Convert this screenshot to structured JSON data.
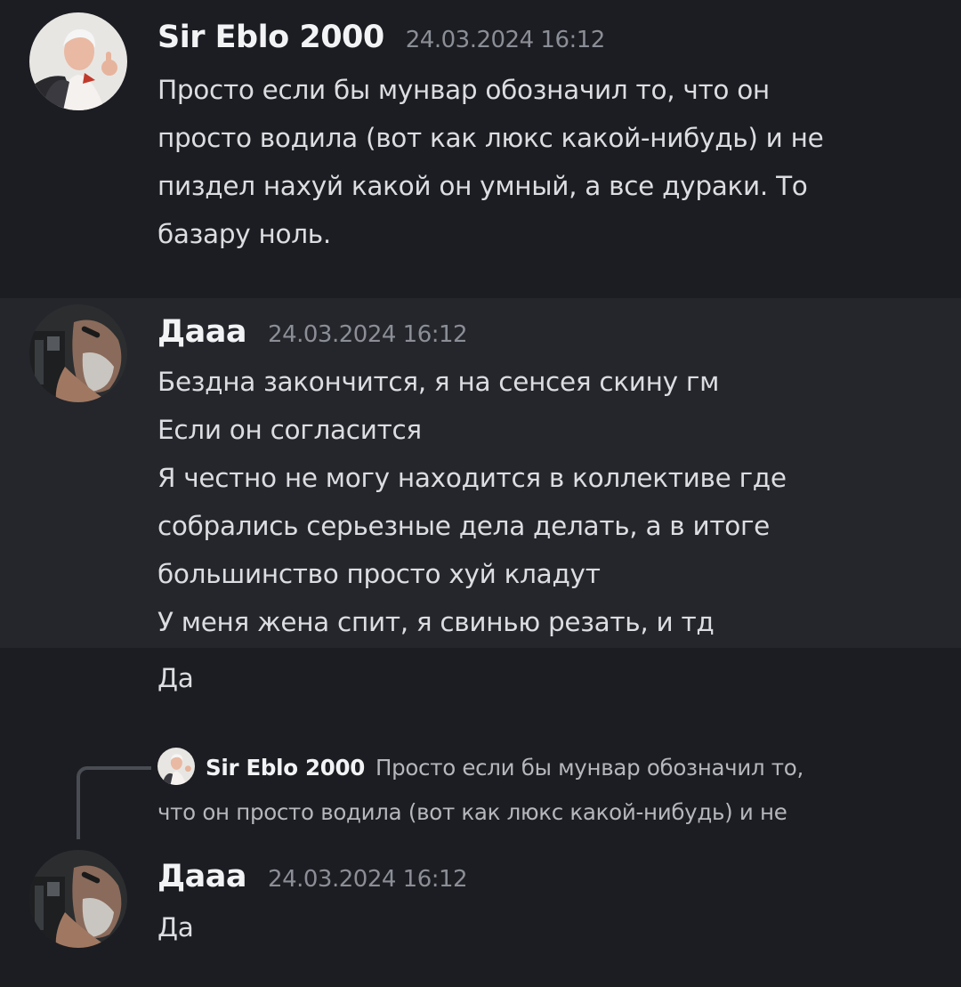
{
  "messages": [
    {
      "author": "Sir Eblo 2000",
      "timestamp": "24.03.2024 16:12",
      "lines": [
        "Просто если бы мунвар обозначил то, что он",
        "просто водила (вот как люкс какой-нибудь) и не",
        "пиздел нахуй какой он умный, а все дураки. То",
        "базару ноль."
      ]
    },
    {
      "author": "Дааа",
      "timestamp": "24.03.2024 16:12",
      "lines": [
        "Бездна закончится, я на сенсея скину гм",
        "Если он согласится",
        "Я честно не могу находится в коллективе где",
        "собрались серьезные дела делать, а в итоге",
        "большинство просто хуй кладут",
        "У меня жена спит, я свинью резать, и тд"
      ]
    },
    {
      "lines": [
        "Да"
      ]
    },
    {
      "reply": {
        "author": "Sir Eblo 2000",
        "lines": [
          "Просто если бы мунвар обозначил то,",
          "что он просто водила (вот как люкс какой-нибудь) и не"
        ]
      },
      "author": "Дааа",
      "timestamp": "24.03.2024 16:12",
      "lines": [
        "Да"
      ]
    }
  ],
  "colors": {
    "background": "#1c1d22",
    "highlight": "#24262c",
    "author": "#f2f3f5",
    "timestamp": "#8b8e96",
    "text": "#dcdde1"
  }
}
